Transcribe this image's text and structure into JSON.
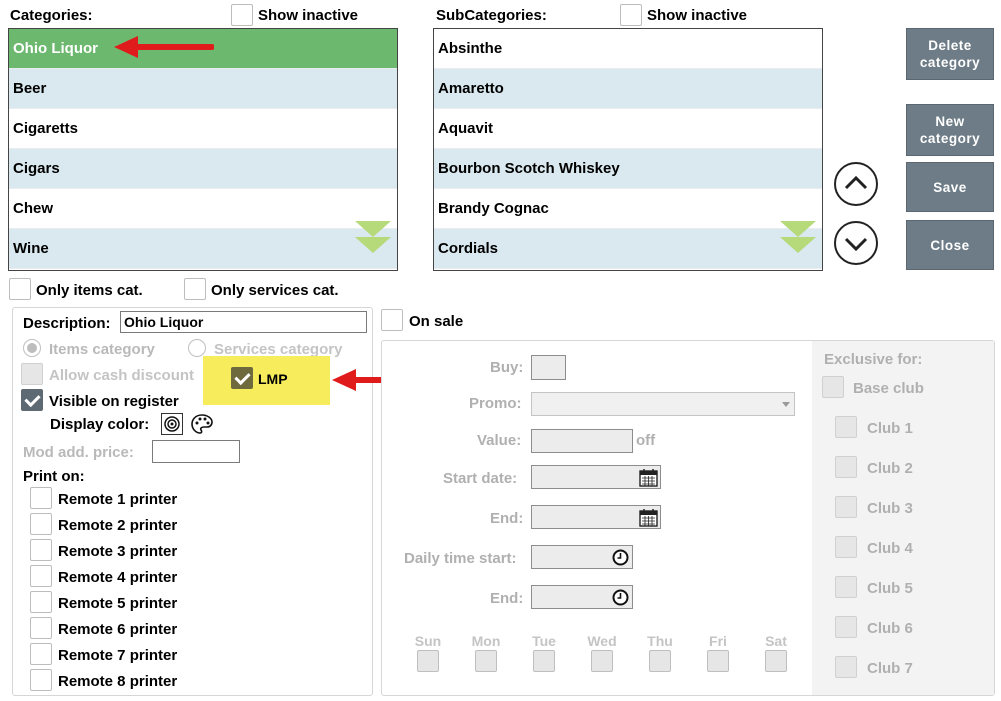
{
  "categories": {
    "header": "Categories:",
    "show_inactive": "Show inactive",
    "items": [
      "Ohio Liquor",
      "Beer",
      "Cigaretts",
      "Cigars",
      "Chew",
      "Wine"
    ]
  },
  "subcategories": {
    "header": "SubCategories:",
    "show_inactive": "Show inactive",
    "items": [
      "Absinthe",
      "Amaretto",
      "Aquavit",
      "Bourbon Scotch Whiskey",
      "Brandy Cognac",
      "Cordials"
    ]
  },
  "buttons": {
    "delete": "Delete category",
    "new": "New category",
    "save": "Save",
    "close": "Close"
  },
  "filters": {
    "only_items": "Only items cat.",
    "only_services": "Only services cat."
  },
  "details": {
    "description_label": "Description:",
    "description_value": "Ohio Liquor",
    "items_category": "Items category",
    "services_category": "Services category",
    "allow_cash_discount": "Allow cash discount",
    "lmp": "LMP",
    "visible_on_register": "Visible on register",
    "display_color": "Display color:",
    "mod_add_price": "Mod add. price:",
    "print_on": "Print on:",
    "printers": [
      "Remote 1 printer",
      "Remote 2 printer",
      "Remote 3 printer",
      "Remote 4 printer",
      "Remote 5 printer",
      "Remote 6 printer",
      "Remote 7 printer",
      "Remote 8 printer"
    ]
  },
  "sale": {
    "on_sale": "On sale",
    "buy": "Buy:",
    "promo": "Promo:",
    "value": "Value:",
    "off": "off",
    "start_date": "Start date:",
    "end": "End:",
    "daily_time_start": "Daily time start:",
    "end2": "End:",
    "days": [
      "Sun",
      "Mon",
      "Tue",
      "Wed",
      "Thu",
      "Fri",
      "Sat"
    ]
  },
  "exclusive": {
    "header": "Exclusive for:",
    "base_club": "Base club",
    "clubs": [
      "Club 1",
      "Club 2",
      "Club 3",
      "Club 4",
      "Club 5",
      "Club 6",
      "Club 7"
    ]
  },
  "colors": {
    "selected_row": "#6cb86e",
    "alt_row": "#d9e9ef",
    "button": "#6d7c86",
    "highlight": "#f7ec5c",
    "arrow": "#e01b1b"
  }
}
